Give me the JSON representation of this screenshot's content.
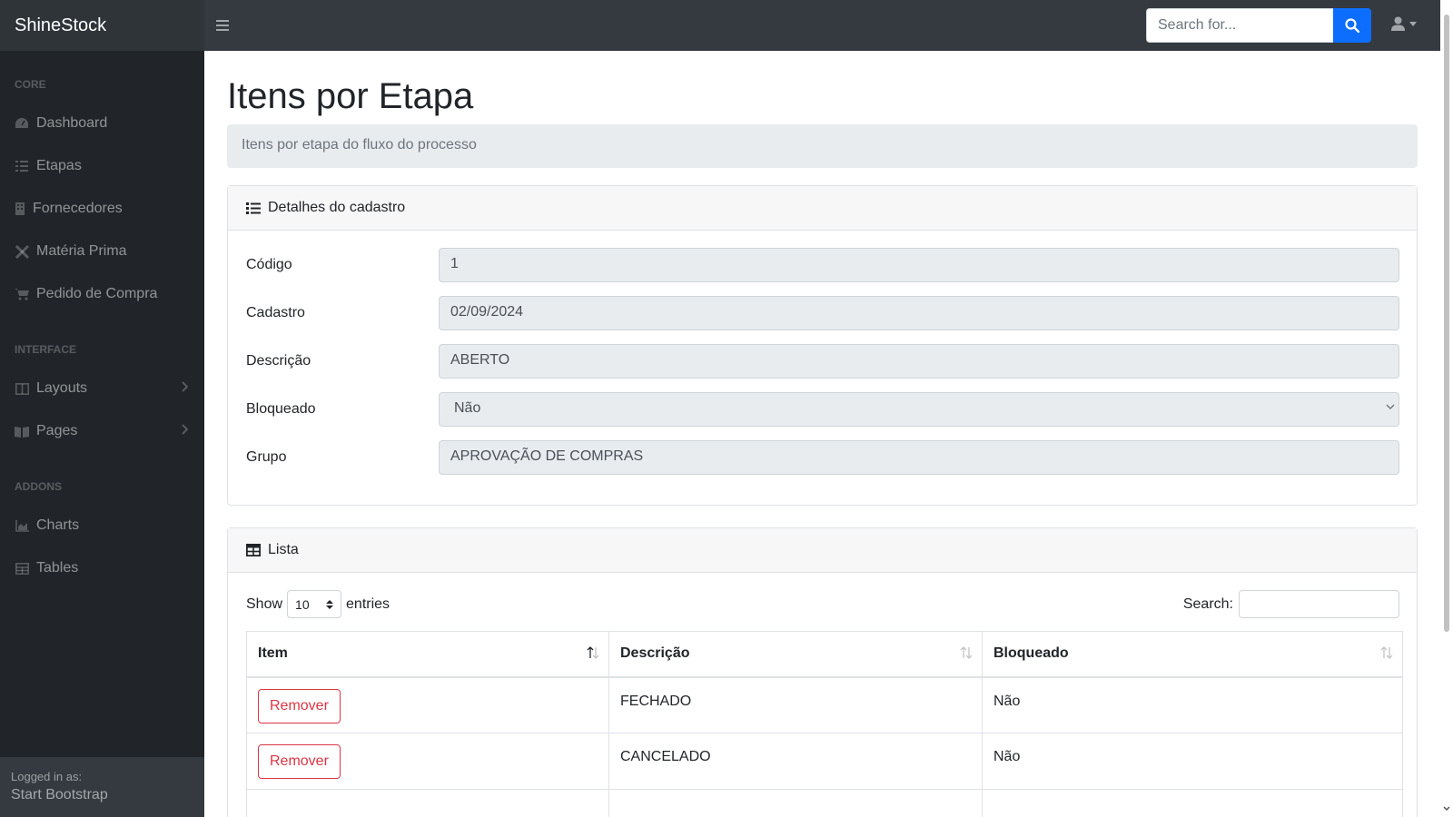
{
  "app": {
    "brand": "ShineStock"
  },
  "topnav": {
    "search_placeholder": "Search for...",
    "menu_icon": "bars-icon",
    "search_icon": "search-icon",
    "user_icon": "user-icon"
  },
  "sidebar": {
    "headings": {
      "core": "CORE",
      "interface": "INTERFACE",
      "addons": "ADDONS"
    },
    "items": [
      {
        "label": "Dashboard",
        "icon": "tachometer-icon"
      },
      {
        "label": "Etapas",
        "icon": "list-check-icon"
      },
      {
        "label": "Fornecedores",
        "icon": "building-icon"
      },
      {
        "label": "Matéria Prima",
        "icon": "tools-icon"
      },
      {
        "label": "Pedido de Compra",
        "icon": "cart-icon"
      },
      {
        "label": "Layouts",
        "icon": "columns-icon"
      },
      {
        "label": "Pages",
        "icon": "book-open-icon"
      },
      {
        "label": "Charts",
        "icon": "area-chart-icon"
      },
      {
        "label": "Tables",
        "icon": "table-icon"
      }
    ],
    "footer": {
      "logged_in_as": "Logged in as:",
      "user": "Start Bootstrap"
    }
  },
  "page": {
    "title": "Itens por Etapa",
    "breadcrumb": "Itens por etapa do fluxo do processo"
  },
  "details_card": {
    "header": "Detalhes do cadastro",
    "fields": [
      {
        "label": "Código",
        "value": "1"
      },
      {
        "label": "Cadastro",
        "value": "02/09/2024"
      },
      {
        "label": "Descrição",
        "value": "ABERTO"
      },
      {
        "label": "Bloqueado",
        "value": "Não"
      },
      {
        "label": "Grupo",
        "value": "APROVAÇÃO DE COMPRAS"
      }
    ]
  },
  "list_card": {
    "header": "Lista",
    "show_label": "Show",
    "entries_value": "10",
    "entries_label": "entries",
    "search_label": "Search:",
    "columns": [
      "Item",
      "Descrição",
      "Bloqueado"
    ],
    "rows": [
      {
        "action": "Remover",
        "descricao": "FECHADO",
        "bloqueado": "Não"
      },
      {
        "action": "Remover",
        "descricao": "CANCELADO",
        "bloqueado": "Não"
      }
    ]
  },
  "colors": {
    "navbar": "#343a40",
    "sidebar": "#212529",
    "primary": "#0d6efd",
    "danger": "#dc3545"
  }
}
